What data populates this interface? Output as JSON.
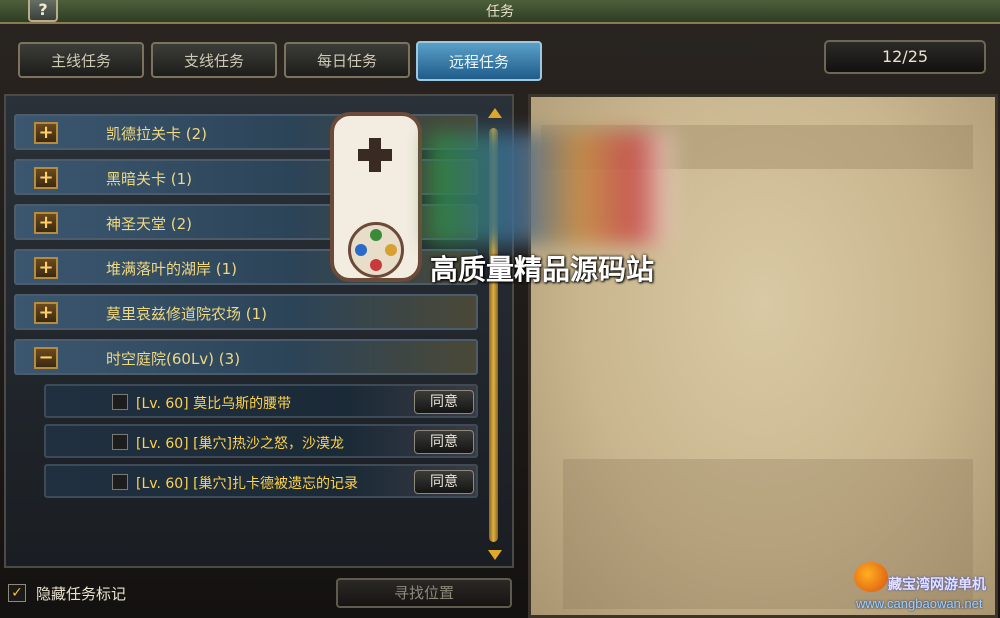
{
  "window": {
    "title": "任务",
    "help_label": "?"
  },
  "tabs": [
    {
      "label": "主线任务"
    },
    {
      "label": "支线任务"
    },
    {
      "label": "每日任务"
    },
    {
      "label": "远程任务",
      "active": true
    }
  ],
  "counter": "12/25",
  "categories": [
    {
      "toggle": "+",
      "label": "凯德拉关卡 (2)"
    },
    {
      "toggle": "+",
      "label": "黑暗关卡 (1)"
    },
    {
      "toggle": "+",
      "label": "神圣天堂 (2)"
    },
    {
      "toggle": "+",
      "label": "堆满落叶的湖岸 (1)"
    },
    {
      "toggle": "+",
      "label": "莫里哀兹修道院农场 (1)"
    },
    {
      "toggle": "−",
      "label": "时空庭院(60Lv) (3)"
    }
  ],
  "quests": [
    {
      "label": "[Lv. 60] 莫比乌斯的腰带",
      "button": "同意"
    },
    {
      "label": "[Lv. 60] [巢穴]热沙之怒，沙漠龙",
      "button": "同意"
    },
    {
      "label": "[Lv. 60] [巢穴]扎卡德被遗忘的记录",
      "button": "同意"
    }
  ],
  "bottom": {
    "hide_checked_mark": "✓",
    "hide_label": "隐藏任务标记",
    "find_label": "寻找位置"
  },
  "watermark": {
    "text": "高质量精品源码站"
  },
  "site_logo": {
    "name": "藏宝湾网游单机",
    "url": "www.cangbaowan.net"
  },
  "colors": {
    "category_text": "#f0d880",
    "quest_text": "#ffd24a",
    "active_tab": "#3f86b8",
    "scrollbar": "#e0b040"
  }
}
